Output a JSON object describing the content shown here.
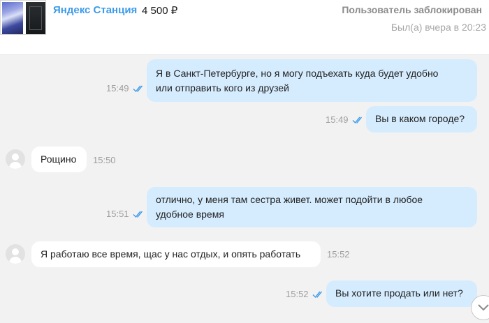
{
  "header": {
    "product_title": "Яндекс Станция",
    "price": "4 500 ₽",
    "status": "Пользователь заблокирован",
    "last_seen": "Был(а) вчера в 20:23"
  },
  "messages": [
    {
      "direction": "out",
      "line1": "Я в Санкт-Петербурге, но я могу подъехать куда будет удобно",
      "line2": "или отправить кого из друзей",
      "time": "15:49",
      "read": true
    },
    {
      "direction": "out",
      "text": "Вы в каком городе?",
      "time": "15:49",
      "read": true
    },
    {
      "direction": "in",
      "text": "Рощино",
      "time": "15:50"
    },
    {
      "direction": "out",
      "line1": "отлично, у меня там сестра живет. может подойти в любое",
      "line2": "удобное время",
      "time": "15:51",
      "read": true
    },
    {
      "direction": "in",
      "text": "Я работаю все время, щас у нас отдых, и опять работать",
      "time": "15:52"
    },
    {
      "direction": "out",
      "text": "Вы хотите продать или нет?",
      "time": "15:52",
      "read": true
    }
  ],
  "colors": {
    "accent": "#3d9be9",
    "outgoing_bubble": "#d5ecfe",
    "incoming_bubble": "#ffffff"
  },
  "icons": {
    "read_status": "double-check-icon",
    "avatar": "user-avatar-icon",
    "scroll": "chevron-down-icon"
  }
}
